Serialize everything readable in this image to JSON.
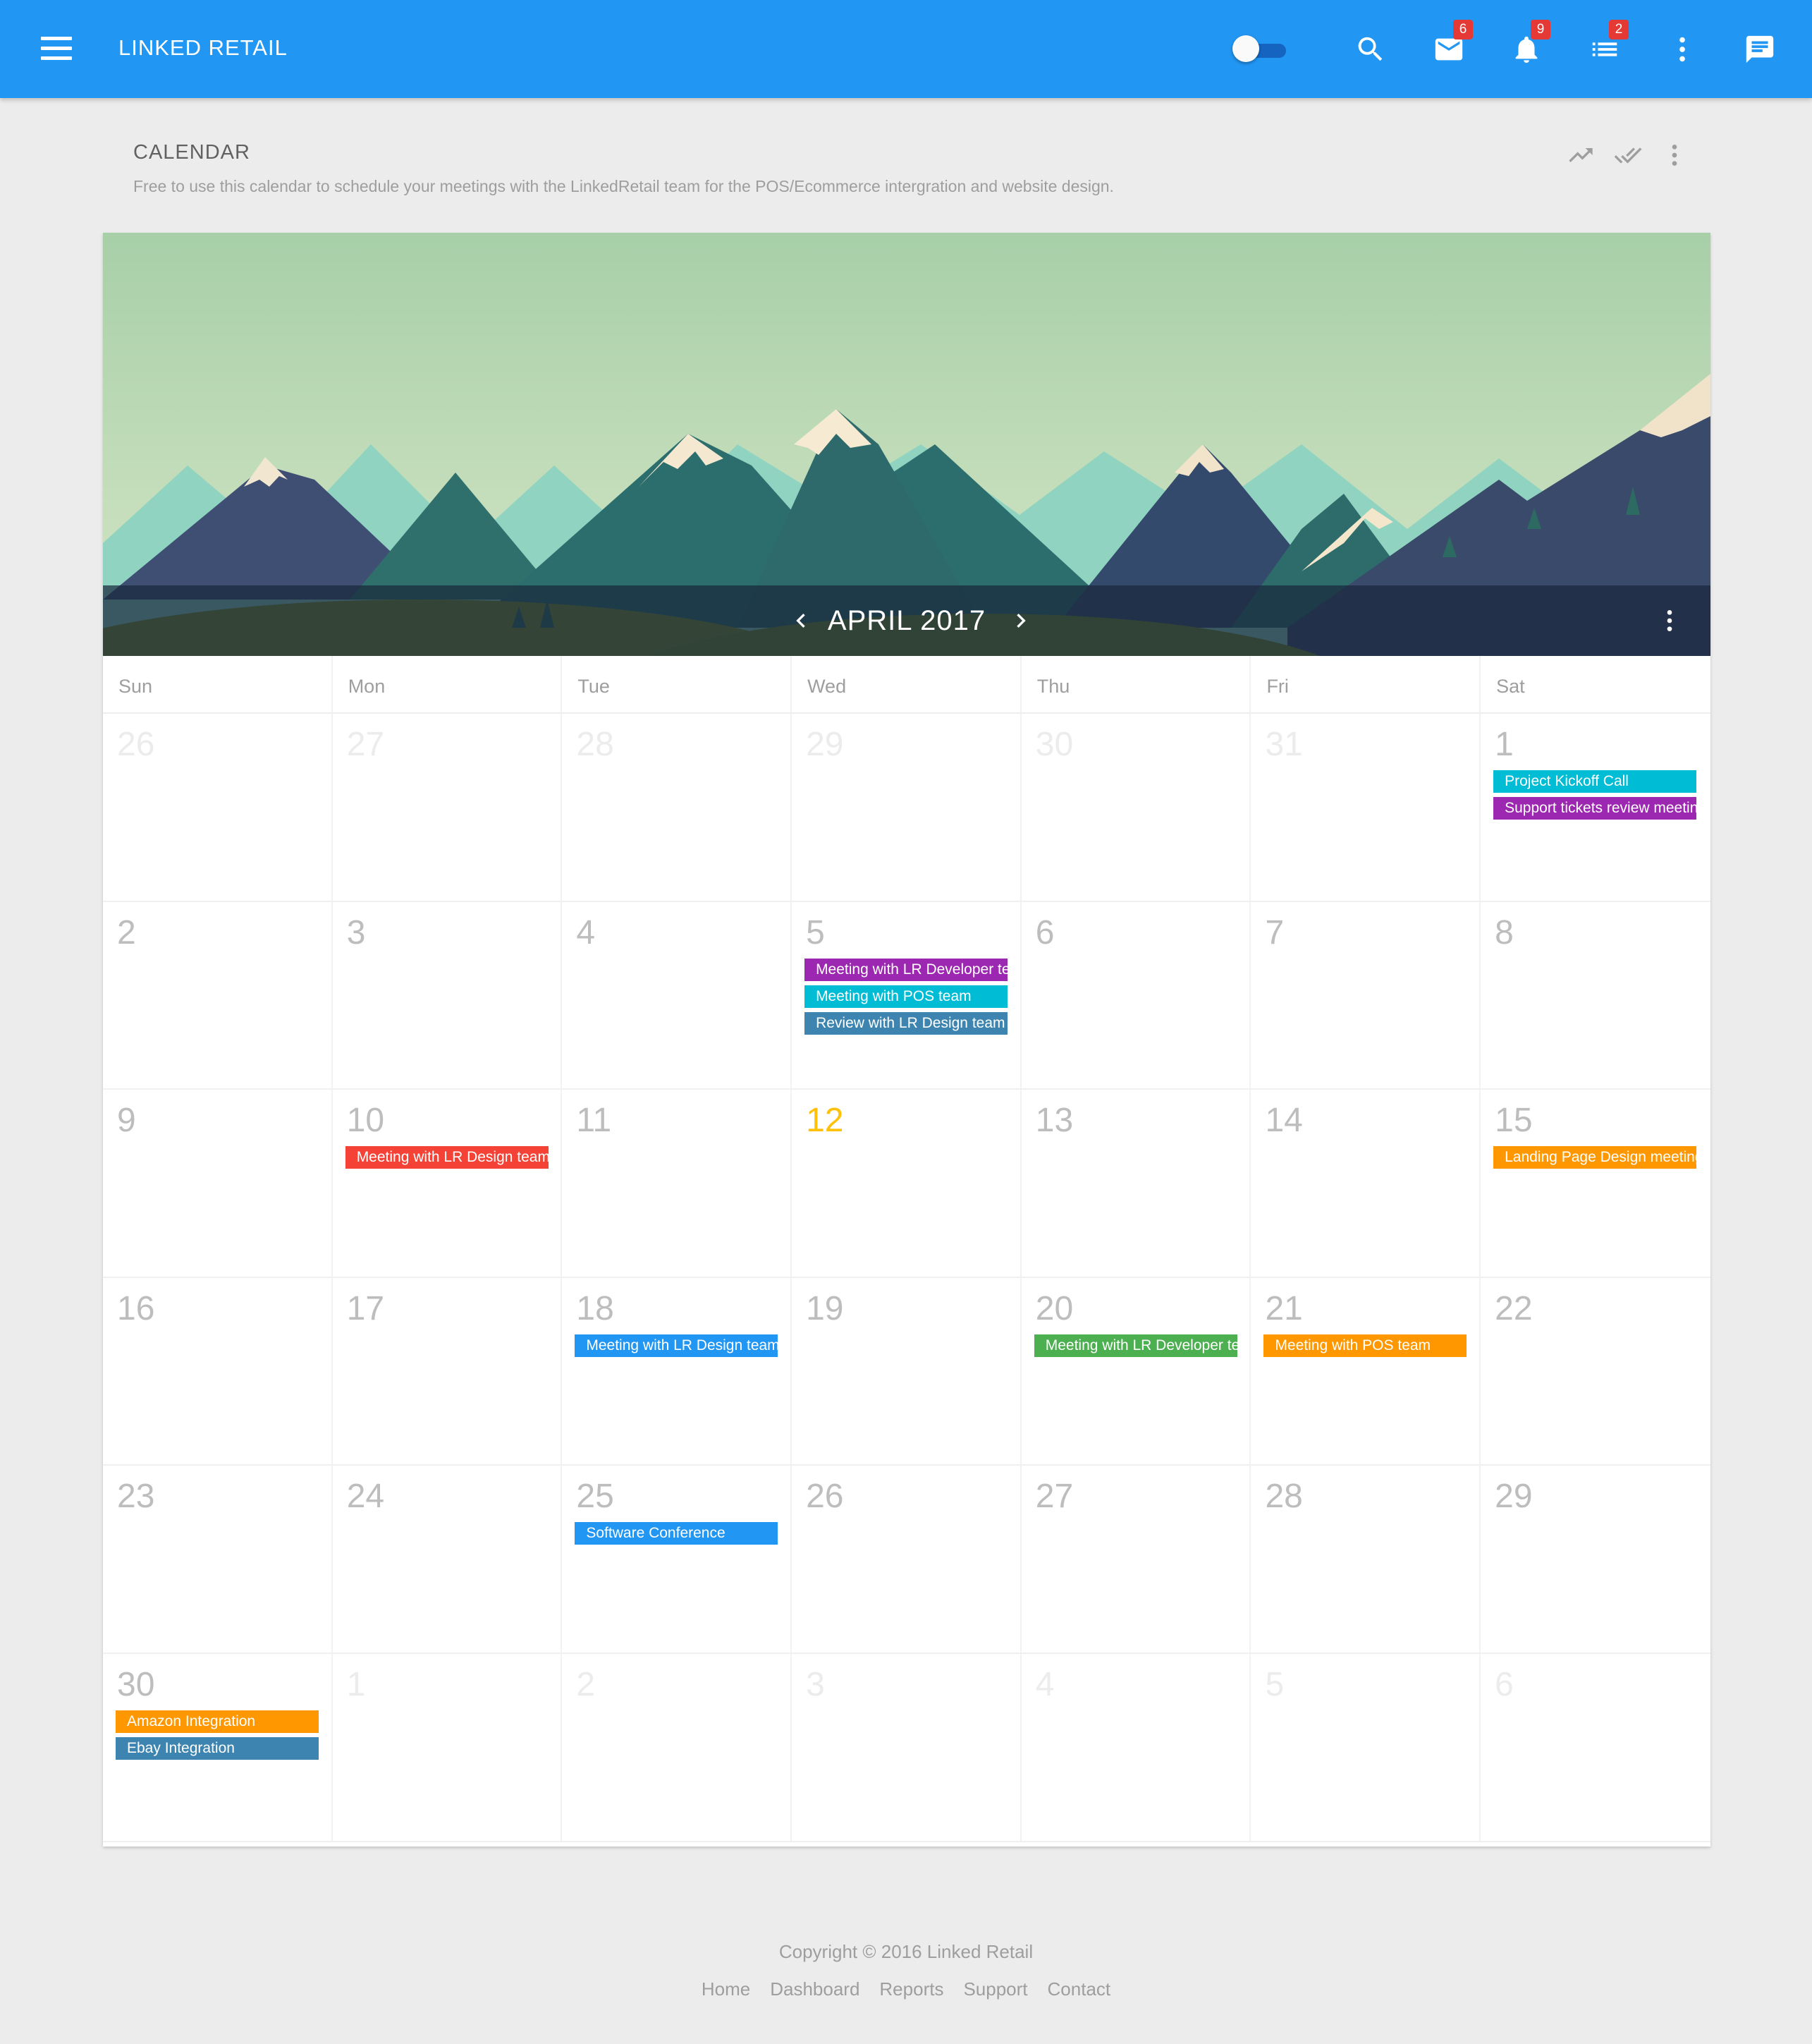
{
  "app": {
    "title": "LINKED RETAIL"
  },
  "topbar": {
    "icons": [
      "menu-icon",
      "toggle-switch",
      "search-icon",
      "mail-icon",
      "bell-icon",
      "list-icon",
      "more-vert-icon",
      "chat-icon"
    ],
    "badges": {
      "mail": "6",
      "notifications": "9",
      "tasks": "2"
    },
    "toggle_on": false
  },
  "header": {
    "title": "CALENDAR",
    "description": "Free to use this calendar to schedule your meetings with the LinkedRetail team for the POS/Ecommerce intergration and website design."
  },
  "calendar": {
    "month_label": "APRIL 2017",
    "days_of_week": [
      "Sun",
      "Mon",
      "Tue",
      "Wed",
      "Thu",
      "Fri",
      "Sat"
    ],
    "weeks": [
      [
        {
          "n": "26",
          "other": true,
          "events": []
        },
        {
          "n": "27",
          "other": true,
          "events": []
        },
        {
          "n": "28",
          "other": true,
          "events": []
        },
        {
          "n": "29",
          "other": true,
          "events": []
        },
        {
          "n": "30",
          "other": true,
          "events": []
        },
        {
          "n": "31",
          "other": true,
          "events": []
        },
        {
          "n": "1",
          "events": [
            {
              "title": "Project Kickoff Call",
              "color": "#00bcd4"
            },
            {
              "title": "Support tickets review meeting",
              "color": "#9c27b0"
            }
          ]
        }
      ],
      [
        {
          "n": "2",
          "events": []
        },
        {
          "n": "3",
          "events": []
        },
        {
          "n": "4",
          "events": []
        },
        {
          "n": "5",
          "events": [
            {
              "title": "Meeting with LR Developer team",
              "color": "#9c27b0"
            },
            {
              "title": "Meeting with POS team",
              "color": "#00bcd4"
            },
            {
              "title": "Review with LR Design team",
              "color": "#3d85b0"
            }
          ]
        },
        {
          "n": "6",
          "events": []
        },
        {
          "n": "7",
          "events": []
        },
        {
          "n": "8",
          "events": []
        }
      ],
      [
        {
          "n": "9",
          "events": []
        },
        {
          "n": "10",
          "events": [
            {
              "title": "Meeting with LR Design team",
              "color": "#f44336"
            }
          ]
        },
        {
          "n": "11",
          "events": []
        },
        {
          "n": "12",
          "today": true,
          "events": []
        },
        {
          "n": "13",
          "events": []
        },
        {
          "n": "14",
          "events": []
        },
        {
          "n": "15",
          "events": [
            {
              "title": "Landing Page Design meeting",
              "color": "#ff9800"
            }
          ]
        }
      ],
      [
        {
          "n": "16",
          "events": []
        },
        {
          "n": "17",
          "events": []
        },
        {
          "n": "18",
          "events": [
            {
              "title": "Meeting with LR Design team",
              "color": "#2196f3"
            }
          ]
        },
        {
          "n": "19",
          "events": []
        },
        {
          "n": "20",
          "events": [
            {
              "title": "Meeting with LR Developer team",
              "color": "#4caf50"
            }
          ]
        },
        {
          "n": "21",
          "events": [
            {
              "title": "Meeting with POS team",
              "color": "#ff9800"
            }
          ]
        },
        {
          "n": "22",
          "events": []
        }
      ],
      [
        {
          "n": "23",
          "events": []
        },
        {
          "n": "24",
          "events": []
        },
        {
          "n": "25",
          "events": [
            {
              "title": "Software Conference",
              "color": "#2196f3"
            }
          ]
        },
        {
          "n": "26",
          "events": []
        },
        {
          "n": "27",
          "events": []
        },
        {
          "n": "28",
          "events": []
        },
        {
          "n": "29",
          "events": []
        }
      ],
      [
        {
          "n": "30",
          "events": [
            {
              "title": "Amazon Integration",
              "color": "#ff9800"
            },
            {
              "title": "Ebay Integration",
              "color": "#3d85b0"
            }
          ]
        },
        {
          "n": "1",
          "other": true,
          "events": []
        },
        {
          "n": "2",
          "other": true,
          "events": []
        },
        {
          "n": "3",
          "other": true,
          "events": []
        },
        {
          "n": "4",
          "other": true,
          "events": []
        },
        {
          "n": "5",
          "other": true,
          "events": []
        },
        {
          "n": "6",
          "other": true,
          "events": []
        }
      ]
    ]
  },
  "footer": {
    "copyright": "Copyright © 2016 Linked Retail",
    "links": [
      "Home",
      "Dashboard",
      "Reports",
      "Support",
      "Contact"
    ]
  },
  "colors": {
    "primary": "#2196f3",
    "today": "#ffc107",
    "badge": "#e53935"
  }
}
